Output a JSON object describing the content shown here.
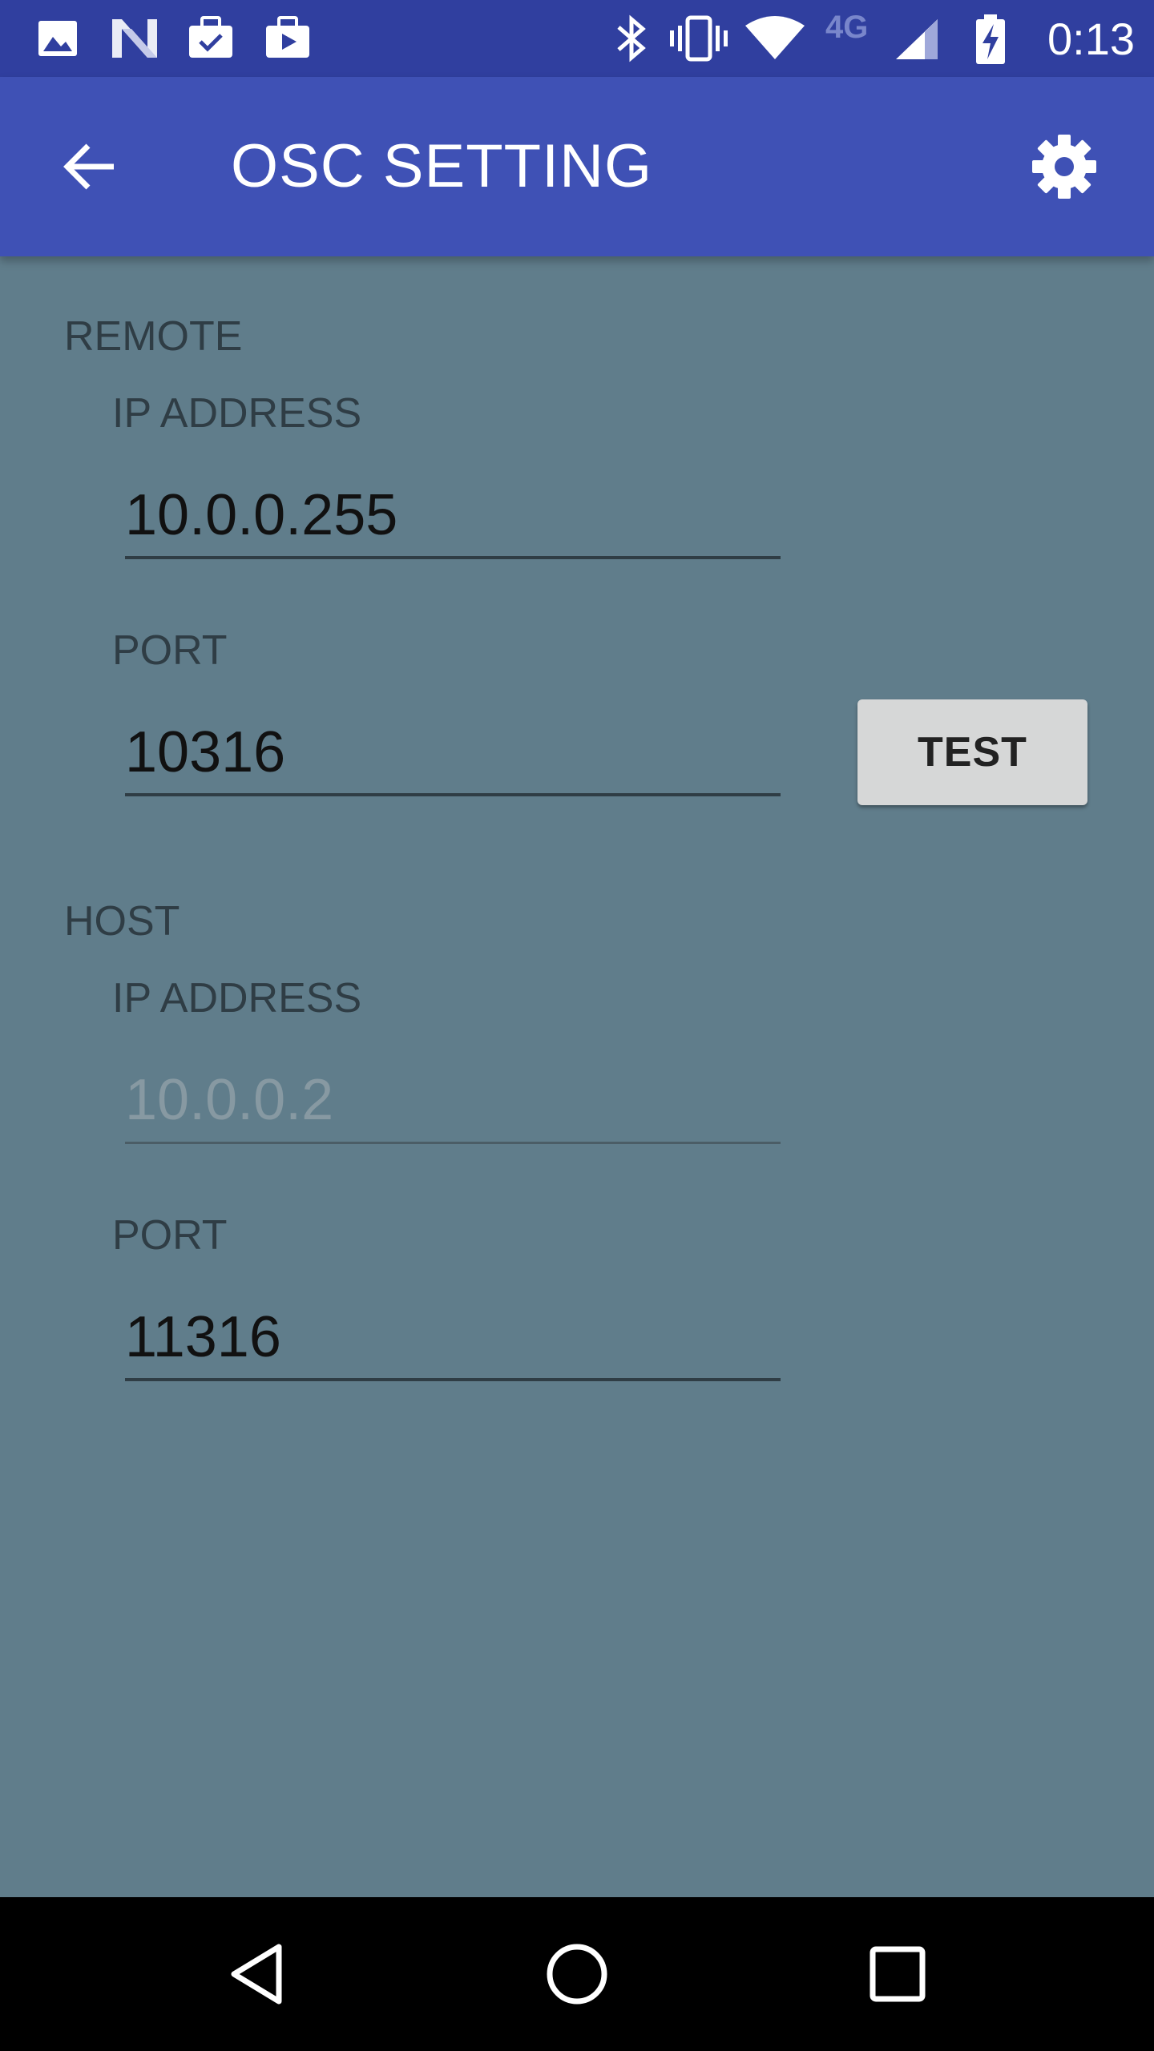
{
  "status_bar": {
    "time": "0:13",
    "network_type": "4G",
    "icons": [
      "image-icon",
      "n-logo-icon",
      "briefcase-check-icon",
      "briefcase-play-icon",
      "bluetooth-icon",
      "vibrate-icon",
      "wifi-icon",
      "cellular-signal-icon",
      "battery-charging-icon"
    ]
  },
  "app_bar": {
    "title": "OSC SETTING",
    "back_icon": "arrow-back-icon",
    "settings_icon": "gear-icon"
  },
  "remote": {
    "section_label": "REMOTE",
    "ip_label": "IP ADDRESS",
    "ip_value": "10.0.0.255",
    "port_label": "PORT",
    "port_value": "10316",
    "test_button": "TEST"
  },
  "host": {
    "section_label": "HOST",
    "ip_label": "IP ADDRESS",
    "ip_value": "10.0.0.2",
    "port_label": "PORT",
    "port_value": "11316"
  },
  "nav_bar": {
    "icons": [
      "back-triangle-icon",
      "home-circle-icon",
      "recents-square-icon"
    ]
  },
  "colors": {
    "status_bar": "#303f9f",
    "app_bar": "#3f51b5",
    "background": "#607d8b",
    "button": "#d6d7d7"
  }
}
